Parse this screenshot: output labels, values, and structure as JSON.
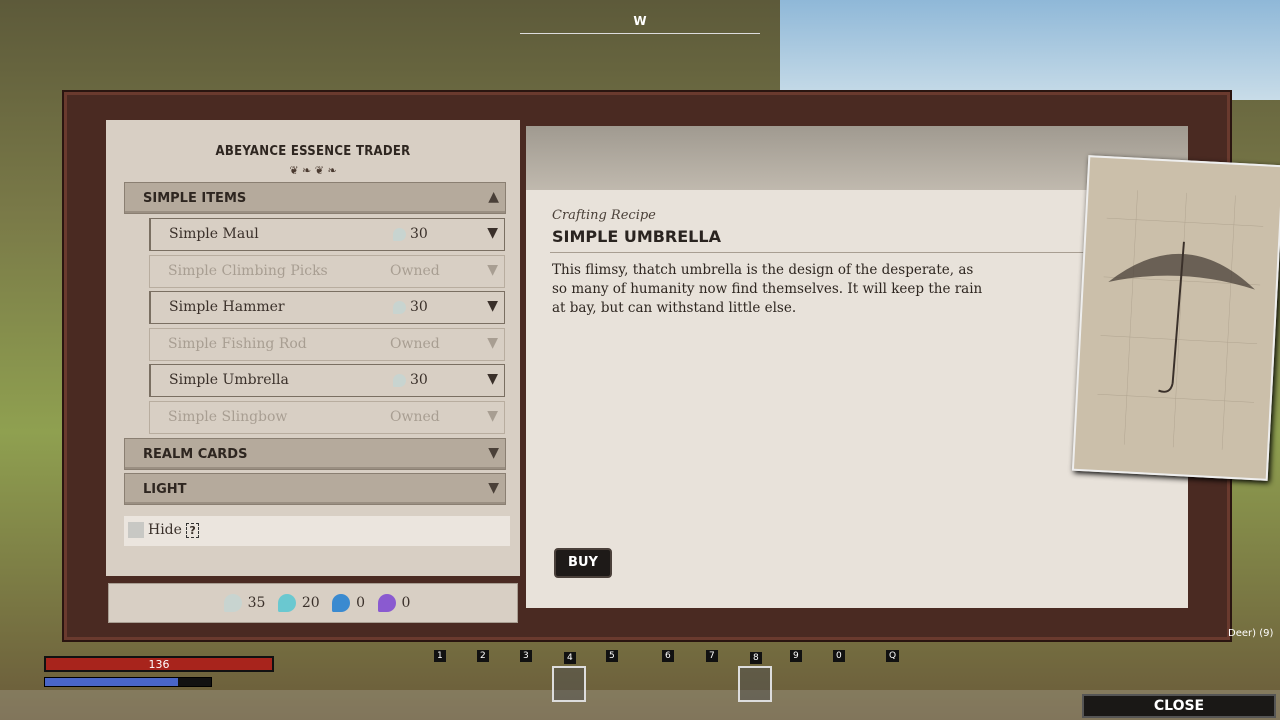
{
  "compass": {
    "heading": "W"
  },
  "trader": {
    "title": "ABEYANCE ESSENCE TRADER"
  },
  "categories": [
    {
      "label": "SIMPLE ITEMS",
      "expanded": true
    },
    {
      "label": "REALM CARDS",
      "expanded": false
    },
    {
      "label": "LIGHT",
      "expanded": false
    }
  ],
  "items": [
    {
      "name": "Simple Maul",
      "price": "30",
      "owned": false
    },
    {
      "name": "Simple Climbing Picks",
      "price": "Owned",
      "owned": true
    },
    {
      "name": "Simple Hammer",
      "price": "30",
      "owned": false
    },
    {
      "name": "Simple Fishing Rod",
      "price": "Owned",
      "owned": true
    },
    {
      "name": "Simple Umbrella",
      "price": "30",
      "owned": false
    },
    {
      "name": "Simple Slingbow",
      "price": "Owned",
      "owned": true
    }
  ],
  "hide": {
    "label": "Hide",
    "help": "?",
    "checked": false
  },
  "currencies": [
    {
      "value": "35",
      "color": "#c8d4d0"
    },
    {
      "value": "20",
      "color": "#6ac8d0"
    },
    {
      "value": "0",
      "color": "#3a8ad0"
    },
    {
      "value": "0",
      "color": "#8a5ad0"
    }
  ],
  "detail": {
    "subtitle": "Crafting Recipe",
    "title": "SIMPLE UMBRELLA",
    "description": "This flimsy, thatch umbrella is the design of the desperate, as so many of humanity now find themselves. It will keep the rain at bay, but can withstand little else.",
    "buy_label": "BUY"
  },
  "hud": {
    "health": "136",
    "mana_fraction": 0.8,
    "hotbar": [
      "1",
      "2",
      "3",
      "4",
      "5",
      "6",
      "7",
      "8",
      "9",
      "0",
      "Q"
    ],
    "selected_slots": [
      "4",
      "8"
    ],
    "tracker": "Deer) (9)",
    "close_label": "CLOSE"
  }
}
